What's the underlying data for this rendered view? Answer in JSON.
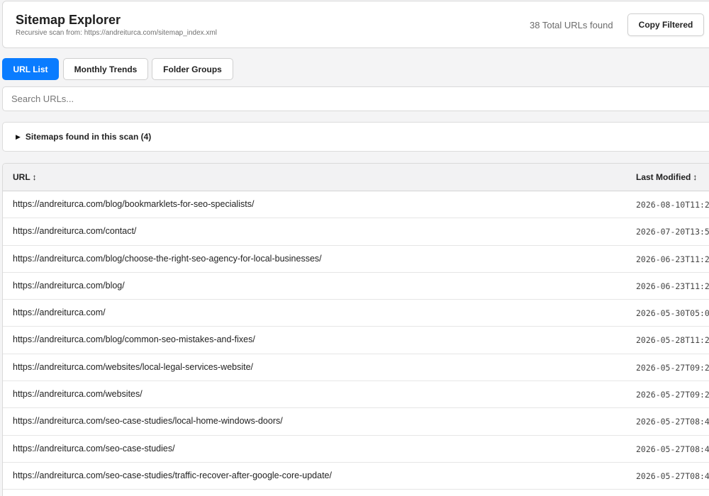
{
  "header": {
    "title": "Sitemap Explorer",
    "subtitle": "Recursive scan from: https://andreiturca.com/sitemap_index.xml",
    "total": "38 Total URLs found",
    "copy_label": "Copy Filtered"
  },
  "tabs": [
    {
      "label": "URL List",
      "active": true
    },
    {
      "label": "Monthly Trends",
      "active": false
    },
    {
      "label": "Folder Groups",
      "active": false
    }
  ],
  "search": {
    "placeholder": "Search URLs..."
  },
  "sitemaps": {
    "label": "Sitemaps found in this scan (4)"
  },
  "table": {
    "columns": {
      "url": "URL",
      "modified": "Last Modified",
      "sort_glyph": "↕"
    },
    "rows": [
      {
        "url": "https://andreiturca.com/blog/bookmarklets-for-seo-specialists/",
        "date": "2026-08-10T11:2"
      },
      {
        "url": "https://andreiturca.com/contact/",
        "date": "2026-07-20T13:5"
      },
      {
        "url": "https://andreiturca.com/blog/choose-the-right-seo-agency-for-local-businesses/",
        "date": "2026-06-23T11:2"
      },
      {
        "url": "https://andreiturca.com/blog/",
        "date": "2026-06-23T11:2"
      },
      {
        "url": "https://andreiturca.com/",
        "date": "2026-05-30T05:0"
      },
      {
        "url": "https://andreiturca.com/blog/common-seo-mistakes-and-fixes/",
        "date": "2026-05-28T11:2"
      },
      {
        "url": "https://andreiturca.com/websites/local-legal-services-website/",
        "date": "2026-05-27T09:2"
      },
      {
        "url": "https://andreiturca.com/websites/",
        "date": "2026-05-27T09:2"
      },
      {
        "url": "https://andreiturca.com/seo-case-studies/local-home-windows-doors/",
        "date": "2026-05-27T08:4"
      },
      {
        "url": "https://andreiturca.com/seo-case-studies/",
        "date": "2026-05-27T08:4"
      },
      {
        "url": "https://andreiturca.com/seo-case-studies/traffic-recover-after-google-core-update/",
        "date": "2026-05-27T08:4"
      }
    ]
  },
  "colors": {
    "accent": "#0a7cff",
    "background": "#f4f4f5"
  }
}
